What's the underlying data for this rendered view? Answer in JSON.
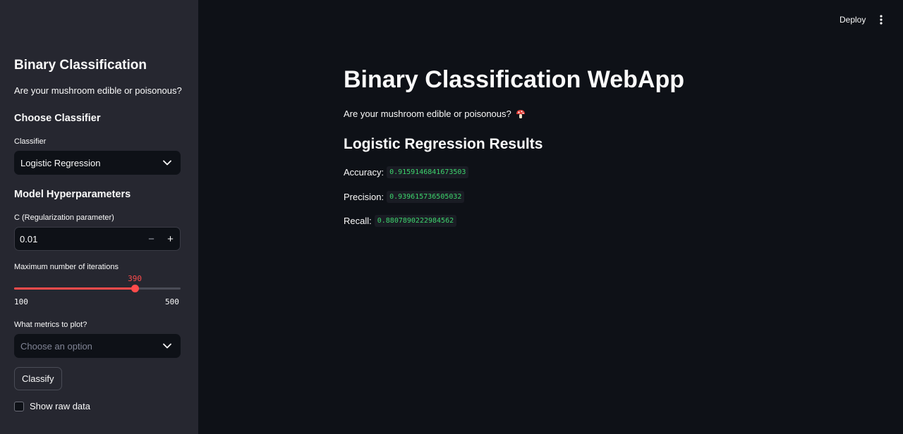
{
  "sidebar": {
    "title": "Binary Classification",
    "subtitle": "Are your mushroom edible or poisonous?",
    "choose_classifier": "Choose Classifier",
    "classifier_label": "Classifier",
    "classifier_value": "Logistic Regression",
    "hyperparameters_title": "Model Hyperparameters",
    "c_label": "C (Regularization parameter)",
    "c_value": "0.01",
    "c_minus": "−",
    "c_plus": "+",
    "iterations_label": "Maximum number of iterations",
    "iterations": {
      "value": 390,
      "min": 100,
      "max": 500,
      "value_text": "390",
      "min_text": "100",
      "max_text": "500"
    },
    "metrics_label": "What metrics to plot?",
    "metrics_placeholder": "Choose an option",
    "classify_label": "Classify",
    "raw_data_label": "Show raw data",
    "raw_data_checked": false,
    "accent_color": "#ff4b4b"
  },
  "header": {
    "deploy_label": "Deploy",
    "menu_icon": "vertical-dots-icon"
  },
  "main": {
    "title": "Binary Classification WebApp",
    "subtitle": "Are your mushroom edible or poisonous?",
    "subtitle_icon": "mushroom-icon",
    "results_title": "Logistic Regression Results",
    "metrics": [
      {
        "label": "Accuracy:",
        "value": "0.9159146841673503"
      },
      {
        "label": "Precision:",
        "value": "0.939615736505032"
      },
      {
        "label": "Recall:",
        "value": "0.8807890222984562"
      }
    ],
    "code_color": "#3dd56d"
  }
}
